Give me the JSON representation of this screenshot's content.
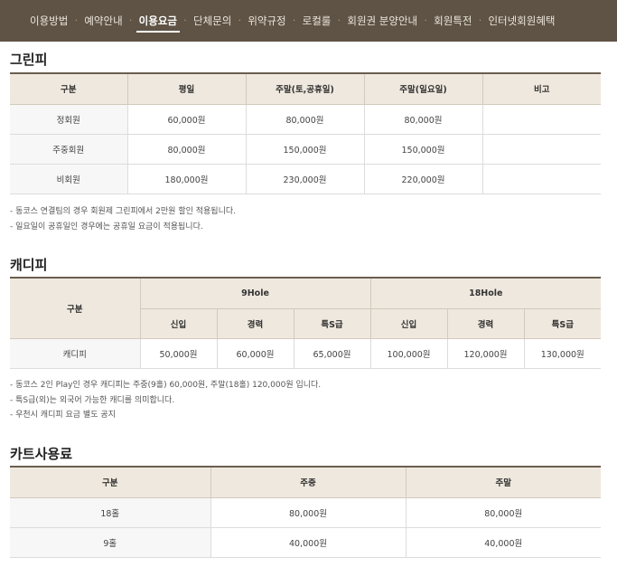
{
  "nav": {
    "items": [
      {
        "label": "이용방법",
        "active": false
      },
      {
        "label": "예약안내",
        "active": false
      },
      {
        "label": "이용요금",
        "active": true
      },
      {
        "label": "단체문의",
        "active": false
      },
      {
        "label": "위약규정",
        "active": false
      },
      {
        "label": "로컬룰",
        "active": false
      },
      {
        "label": "회원권 분양안내",
        "active": false
      },
      {
        "label": "회원특전",
        "active": false
      },
      {
        "label": "인터넷회원혜택",
        "active": false
      }
    ],
    "separator": "·"
  },
  "greenfee": {
    "title": "그린피",
    "headers": [
      "구분",
      "평일",
      "주말(토,공휴일)",
      "주말(일요일)",
      "비고"
    ],
    "rows": [
      [
        "정회원",
        "60,000원",
        "80,000원",
        "80,000원",
        ""
      ],
      [
        "주중회원",
        "80,000원",
        "150,000원",
        "150,000원",
        ""
      ],
      [
        "비회원",
        "180,000원",
        "230,000원",
        "220,000원",
        ""
      ]
    ],
    "notes": [
      "- 동코스 연결팀의 경우 회원제 그린피에서 2만원 할인 적용됩니다.",
      "- 일요일이 공휴일인 경우에는 공휴일 요금이 적용됩니다."
    ]
  },
  "caddie": {
    "title": "캐디피",
    "header_group": "구분",
    "groups": [
      "9Hole",
      "18Hole"
    ],
    "subheaders": [
      "신입",
      "경력",
      "특S급",
      "신입",
      "경력",
      "특S급"
    ],
    "row_label": "캐디피",
    "row_values": [
      "50,000원",
      "60,000원",
      "65,000원",
      "100,000원",
      "120,000원",
      "130,000원"
    ],
    "notes": [
      "- 동코스 2인 Play인 경우 캐디피는 주중(9홀) 60,000원, 주말(18홀) 120,000원 입니다.",
      "- 특S급(외)는 외국어 가능한 캐디를 의미합니다.",
      "- 우천시 캐디피 요금 별도 공지"
    ]
  },
  "cart": {
    "title": "카트사용료",
    "headers": [
      "구분",
      "주중",
      "주말"
    ],
    "rows": [
      [
        "18홀",
        "80,000원",
        "80,000원"
      ],
      [
        "9홀",
        "40,000원",
        "40,000원"
      ]
    ]
  }
}
